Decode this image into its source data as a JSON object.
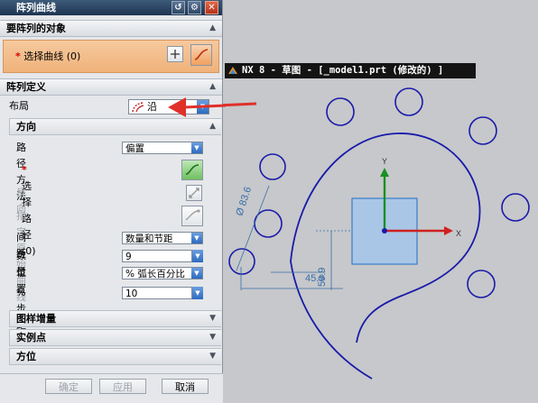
{
  "dialog": {
    "title": "阵列曲线",
    "title_buttons": [
      "reset-icon",
      "gear-icon",
      "close-icon"
    ],
    "section_objects": "要阵列的对象",
    "select_curve_label": "选择曲线",
    "select_curve_count": "(0)",
    "section_definition": "阵列定义",
    "layout_label": "布局",
    "layout_value": "沿",
    "direction_label": "方向",
    "path_method_label": "路径方法",
    "path_method_value": "偏置",
    "select_path_label": "选择路径",
    "select_path_count": "(0)",
    "reverse_label": "反向",
    "origin_curve_label": "指定原始曲线",
    "spacing_label": "间距",
    "spacing_value": "数量和节距",
    "count_label": "数量",
    "count_value": "9",
    "position_label": "位置",
    "position_value": "% 弧长百分比",
    "step_label": "% 步距",
    "step_value": "10",
    "pattern_increment_label": "图样增量",
    "instance_point_label": "实例点",
    "orientation_label": "方位",
    "ok_label": "确定",
    "apply_label": "应用",
    "cancel_label": "取消"
  },
  "window_title": "NX 8 - 草图 - [_model1.prt  (修改的) ]",
  "sketch": {
    "diameter_dim": "Ø 83.6",
    "dim_a": "45.9",
    "dim_b": "59.9",
    "axis_x": "X",
    "axis_y": "Y"
  },
  "colors": {
    "curve": "#1a1aaa",
    "annotation_arrow": "#e0302a",
    "x_axis": "#d02020",
    "y_axis": "#1a9020",
    "rectangle_fill": "#a9c6e6"
  }
}
